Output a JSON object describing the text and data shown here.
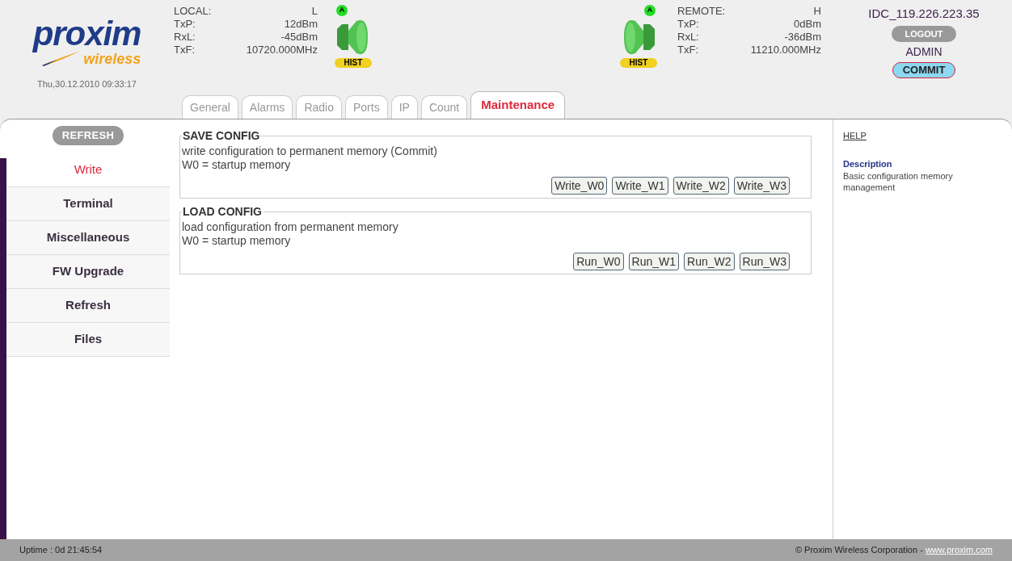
{
  "logo": {
    "brand": "proxim",
    "tagline": "wireless"
  },
  "datetime": "Thu,30.12.2010 09:33:17",
  "local": {
    "title": "LOCAL:",
    "side": "L",
    "rows": [
      {
        "label": "TxP:",
        "value": "12dBm"
      },
      {
        "label": "RxL:",
        "value": "-45dBm"
      },
      {
        "label": "TxF:",
        "value": "10720.000MHz"
      }
    ],
    "status": "A",
    "hist": "HIST"
  },
  "remote": {
    "title": "REMOTE:",
    "side": "H",
    "rows": [
      {
        "label": "TxP:",
        "value": "0dBm"
      },
      {
        "label": "RxL:",
        "value": "-36dBm"
      },
      {
        "label": "TxF:",
        "value": "11210.000MHz"
      }
    ],
    "status": "A",
    "hist": "HIST"
  },
  "session": {
    "host": "IDC_119.226.223.35",
    "logout": "LOGOUT",
    "user": "ADMIN",
    "commit": "COMMIT"
  },
  "tabs": [
    {
      "label": "General",
      "selected": false
    },
    {
      "label": "Alarms",
      "selected": false
    },
    {
      "label": "Radio",
      "selected": false
    },
    {
      "label": "Ports",
      "selected": false
    },
    {
      "label": "IP",
      "selected": false
    },
    {
      "label": "Count",
      "selected": false
    },
    {
      "label": "Maintenance",
      "selected": true
    }
  ],
  "sidebar": {
    "refresh": "REFRESH",
    "items": [
      {
        "label": "Write",
        "selected": true
      },
      {
        "label": "Terminal",
        "selected": false
      },
      {
        "label": "Miscellaneous",
        "selected": false
      },
      {
        "label": "FW Upgrade",
        "selected": false
      },
      {
        "label": "Refresh",
        "selected": false
      },
      {
        "label": "Files",
        "selected": false
      }
    ]
  },
  "sections": [
    {
      "title": "SAVE CONFIG",
      "lines": [
        "write configuration to permanent memory (Commit)",
        "W0 = startup memory"
      ],
      "buttons": [
        "Write_W0",
        "Write_W1",
        "Write_W2",
        "Write_W3"
      ]
    },
    {
      "title": "LOAD CONFIG",
      "lines": [
        "load configuration from permanent memory",
        "W0 = startup memory"
      ],
      "buttons": [
        "Run_W0",
        "Run_W1",
        "Run_W2",
        "Run_W3"
      ]
    }
  ],
  "help": {
    "title": "HELP",
    "heading": "Description",
    "text": "Basic configuration memory management"
  },
  "status_bar": {
    "uptime": "Uptime : 0d 21:45:54",
    "copyright": "© Proxim Wireless Corporation - ",
    "link": "www.proxim.com"
  }
}
